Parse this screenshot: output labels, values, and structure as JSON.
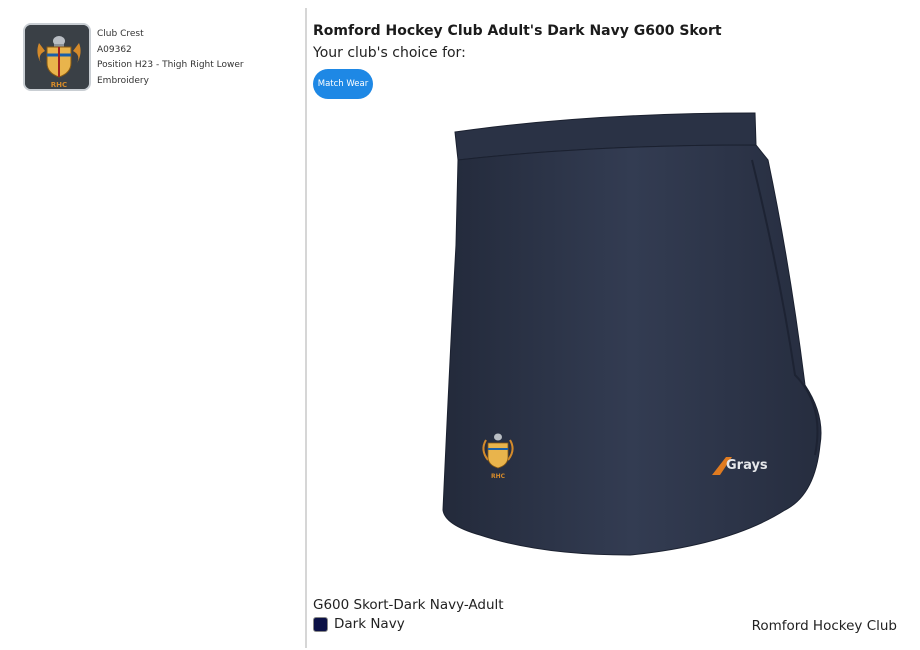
{
  "crest": {
    "name": "Club Crest",
    "code": "A09362",
    "position": "Position H23 - Thigh Right Lower",
    "method": "Embroidery",
    "crest_letters": "RHC"
  },
  "product": {
    "title": "Romford Hockey Club Adult's Dark Navy G600 Skort",
    "choice_text": "Your club's choice for:",
    "tag": "Match Wear",
    "brand_logo_text": "Grays",
    "variant": "G600 Skort-Dark Navy-Adult",
    "colour_name": "Dark Navy",
    "club": "Romford Hockey Club"
  },
  "colors": {
    "accent": "#1e88e5",
    "swatch": "#0c1146",
    "garment": "#2b3346",
    "crest_gold": "#d48a2a"
  }
}
